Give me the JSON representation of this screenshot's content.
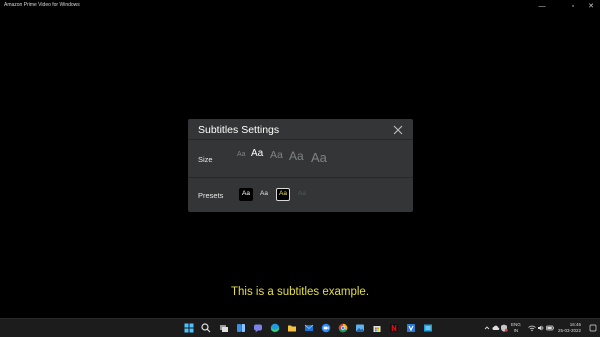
{
  "window": {
    "title": "Amazon Prime Video for Windows",
    "minimize_glyph": "—",
    "maximize_glyph": "▫",
    "close_glyph": "✕"
  },
  "dialog": {
    "title": "Subtitles Settings",
    "close_icon": "close-icon",
    "size_label": "Size",
    "size_options": [
      "Aa",
      "Aa",
      "Aa",
      "Aa",
      "Aa"
    ],
    "size_selected_index": 1,
    "presets_label": "Presets",
    "preset_options": [
      "Aa",
      "Aa",
      "Aa",
      "Aa"
    ],
    "preset_selected_index": 2
  },
  "subtitle_example": "This is a subtitles example.",
  "taskbar": {
    "icons": [
      "windows-start-icon",
      "search-icon",
      "task-view-icon",
      "widgets-icon",
      "teams-chat-icon",
      "edge-icon",
      "file-explorer-icon",
      "mail-icon",
      "zoom-icon",
      "chrome-icon",
      "photos-icon",
      "store-icon",
      "netflix-icon",
      "visual-studio-icon",
      "prime-video-icon"
    ],
    "language_line1": "ENG",
    "language_line2": "IN",
    "time": "16:46",
    "date": "25-03-2022"
  },
  "colors": {
    "dialog_bg": "#333536",
    "subtitle_color": "#e5de4a",
    "taskbar_bg": "#1c1c1c"
  }
}
